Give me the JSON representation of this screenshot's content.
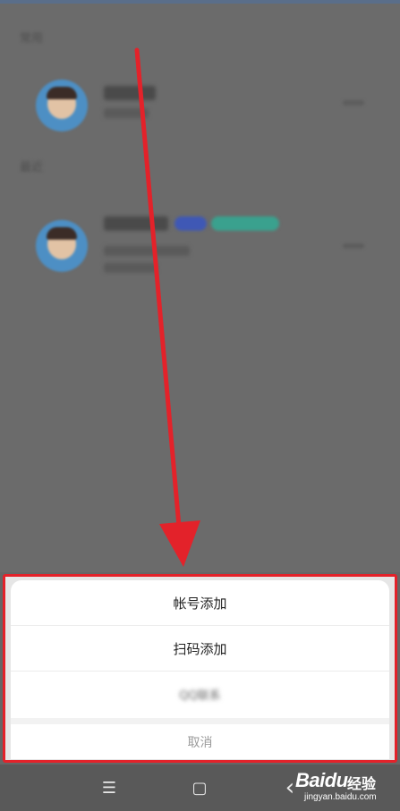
{
  "background": {
    "section_1": "常用",
    "section_2": "最近",
    "contact_1": {
      "name": "欧阳青",
      "sub": "开发工"
    },
    "contact_2": {
      "name": "客户经理",
      "line1": "1234 5678 90",
      "line2": "客户经理"
    }
  },
  "action_sheet": {
    "options": [
      {
        "label": "帐号添加"
      },
      {
        "label": "扫码添加"
      },
      {
        "label": "QQ联系"
      }
    ],
    "cancel_label": "取消"
  },
  "navbar": {
    "menu_icon": "☰",
    "home_icon": "▢",
    "back_icon": "‹"
  },
  "watermark": {
    "brand": "Baidu",
    "cn": "经验",
    "url": "jingyan.baidu.com"
  },
  "colors": {
    "annotation_red": "#e3222a",
    "overlay": "#666666",
    "sheet": "#ffffff",
    "cancel_text": "#9a9a9a"
  }
}
